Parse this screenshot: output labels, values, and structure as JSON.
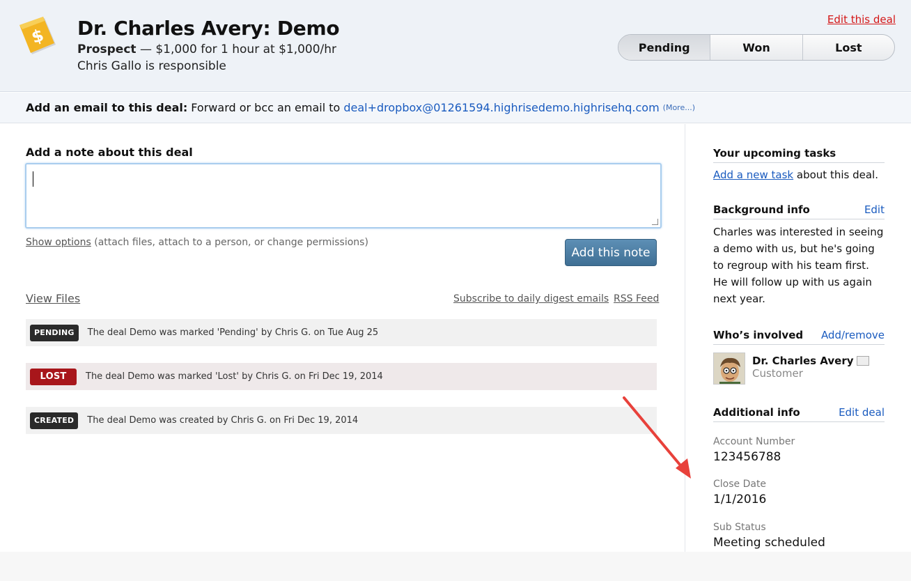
{
  "header": {
    "title": "Dr. Charles Avery: Demo",
    "stage": "Prospect",
    "amount_text": " — $1,000 for 1 hour at $1,000/hr",
    "responsible": "Chris Gallo is responsible",
    "edit_link": "Edit this deal",
    "icon": "dollar-tag-icon",
    "status_buttons": [
      "Pending",
      "Won",
      "Lost"
    ],
    "selected_status": "Pending"
  },
  "email_bar": {
    "label": "Add an email to this deal:",
    "text": "Forward or bcc an email to",
    "address": "deal+dropbox@01261594.highrisedemo.highrisehq.com",
    "more": "(More...)"
  },
  "note": {
    "heading": "Add a note about this deal",
    "value": "",
    "show_options": "Show options",
    "options_hint": " (attach files, attach to a person, or change permissions)",
    "submit_label": "Add this note"
  },
  "links": {
    "view_files": "View Files",
    "subscribe": "Subscribe to daily digest emails",
    "rss": "RSS Feed"
  },
  "activities": [
    {
      "badge": "PENDING",
      "text": "The deal Demo was marked 'Pending' by Chris G. on Tue Aug 25"
    },
    {
      "badge": "LOST",
      "text": "The deal Demo was marked 'Lost' by Chris G. on Fri Dec 19, 2014"
    },
    {
      "badge": "CREATED",
      "text": "The deal Demo was created by Chris G. on Fri Dec 19, 2014"
    }
  ],
  "sidebar": {
    "tasks_heading": "Your upcoming tasks",
    "add_task_link": "Add a new task",
    "add_task_suffix": " about this deal.",
    "background_heading": "Background info",
    "background_edit": "Edit",
    "background_text": "Charles was interested in seeing a demo with us, but he's going to regroup with his team first. He will follow up with us again next year.",
    "involved_heading": "Who’s involved",
    "involved_edit": "Add/remove",
    "person_name": "Dr. Charles Avery",
    "person_role": "Customer",
    "additional_heading": "Additional info",
    "additional_edit": "Edit deal",
    "fields": [
      {
        "label": "Account Number",
        "value": "123456788"
      },
      {
        "label": "Close Date",
        "value": "1/1/2016"
      },
      {
        "label": "Sub Status",
        "value": "Meeting scheduled"
      }
    ]
  },
  "colors": {
    "link": "#1a5bbf",
    "danger_link": "#d41717",
    "lost_badge": "#a8161b",
    "dark_badge": "#2a2a2a",
    "primary_button": "#4a7ca1",
    "annotation_arrow": "#e8413b"
  }
}
